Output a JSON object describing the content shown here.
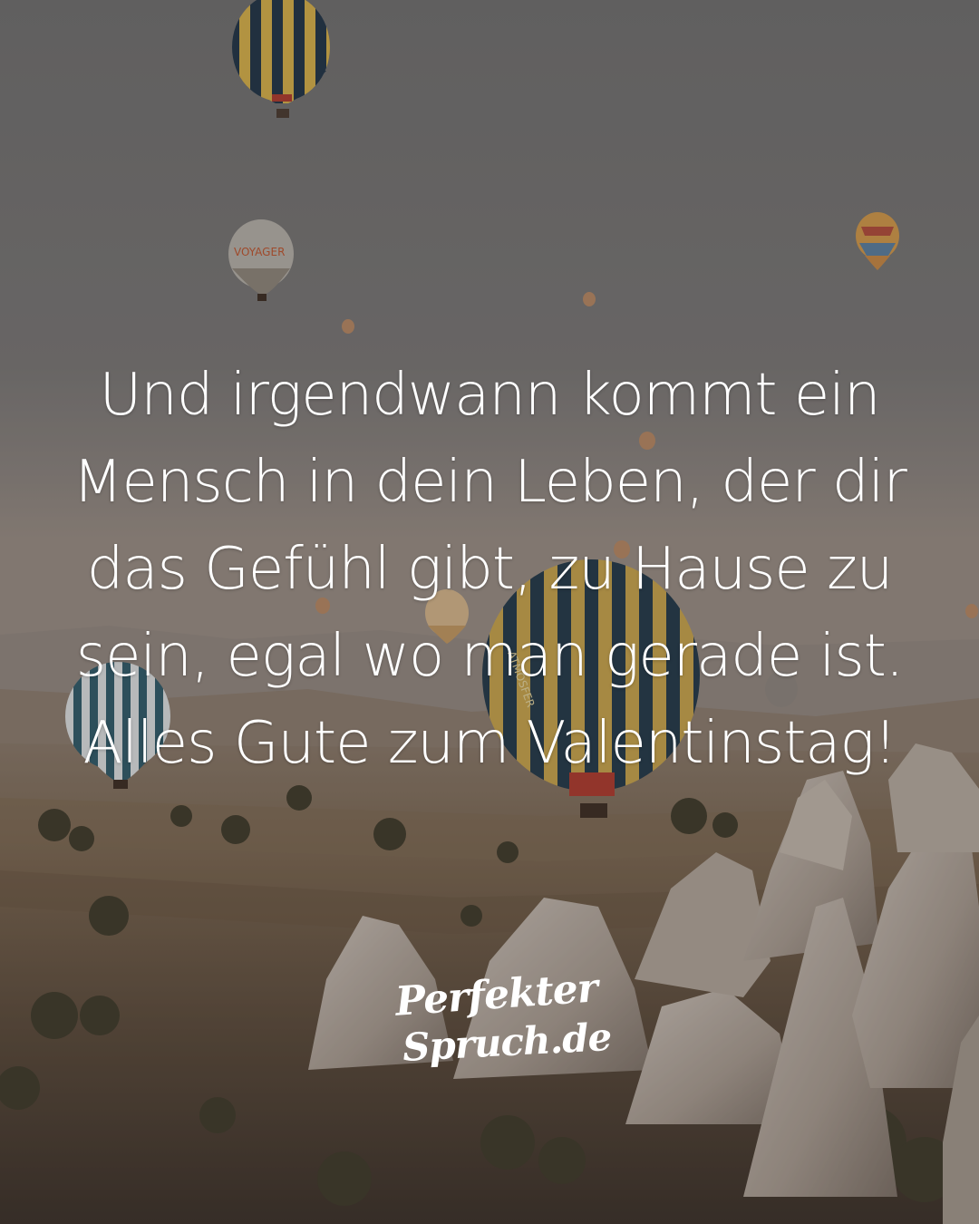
{
  "quote": {
    "lines": [
      "Und irgendwann kommt ein",
      "Mensch in dein Leben, der dir",
      "das Gefühl gibt, zu Hause zu",
      "sein, egal wo man gerade ist.",
      "Alles Gute zum Valentinstag!"
    ]
  },
  "logo": {
    "line1": "Perfekter",
    "line2": "Spruch.de"
  },
  "balloon_lettering": [
    "VOYAGER",
    "ATMOSFER"
  ],
  "colors": {
    "sky": "#7b7b7b",
    "text": "#ffffff",
    "rock": "#b9aea4",
    "balloon_yellow": "#d9b24a",
    "balloon_navy": "#1f3447"
  }
}
